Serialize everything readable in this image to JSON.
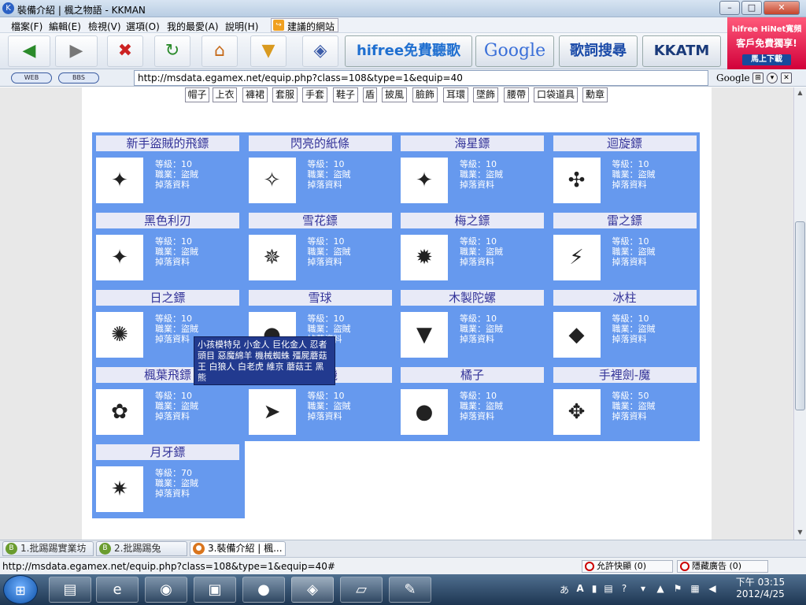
{
  "window": {
    "title": "裝備介紹 | 楓之物語 - KKMAN",
    "icon": "kkman-icon"
  },
  "window_controls": {
    "minimize": "–",
    "maximize": "□",
    "close": "✕"
  },
  "menu": [
    "檔案(F)",
    "編輯(E)",
    "檢視(V)",
    "選項(O)",
    "我的最愛(A)",
    "說明(H)"
  ],
  "suggest_label": "建議的網站",
  "banners": {
    "hifree": "hifree免費聽歌",
    "google": "Google",
    "lyrics": "歌詞搜尋",
    "kkatm": "KKATM"
  },
  "hinet": {
    "line1": "hifree HiNet寬頻",
    "line2": "客戶免費獨享!",
    "button": "馬上下載"
  },
  "address": {
    "pill1": "WEB",
    "pill2": "BBS",
    "url": "http://msdata.egamex.net/equip.php?class=108&type=1&equip=40",
    "search_brand": "Google"
  },
  "categories": [
    "帽子",
    "上衣",
    "褲裙",
    "套服",
    "手套",
    "鞋子",
    "盾",
    "披風",
    "臉飾",
    "耳環",
    "墜飾",
    "腰帶",
    "口袋道具",
    "勳章"
  ],
  "info_labels": {
    "level": "等級：",
    "job": "職業：",
    "drop": "掉落資料"
  },
  "items": [
    {
      "name": "新手盜賊的飛鏢",
      "level": "10",
      "job": "盜賊",
      "icon": "✦"
    },
    {
      "name": "閃亮的紙條",
      "level": "10",
      "job": "盜賊",
      "icon": "✧"
    },
    {
      "name": "海星鏢",
      "level": "10",
      "job": "盜賊",
      "icon": "✦"
    },
    {
      "name": "迴旋鏢",
      "level": "10",
      "job": "盜賊",
      "icon": "✣"
    },
    {
      "name": "黑色利刃",
      "level": "10",
      "job": "盜賊",
      "icon": "✦"
    },
    {
      "name": "雪花鏢",
      "level": "10",
      "job": "盜賊",
      "icon": "✵"
    },
    {
      "name": "梅之鏢",
      "level": "10",
      "job": "盜賊",
      "icon": "✹"
    },
    {
      "name": "雷之鏢",
      "level": "10",
      "job": "盜賊",
      "icon": "⚡"
    },
    {
      "name": "日之鏢",
      "level": "10",
      "job": "盜賊",
      "icon": "✺"
    },
    {
      "name": "雪球",
      "level": "10",
      "job": "盜賊",
      "icon": "●"
    },
    {
      "name": "木製陀螺",
      "level": "10",
      "job": "盜賊",
      "icon": "▼"
    },
    {
      "name": "冰柱",
      "level": "10",
      "job": "盜賊",
      "icon": "◆"
    },
    {
      "name": "楓葉飛鏢",
      "level": "10",
      "job": "盜賊",
      "icon": "✿"
    },
    {
      "name": "紙飛機",
      "level": "10",
      "job": "盜賊",
      "icon": "➤"
    },
    {
      "name": "橘子",
      "level": "10",
      "job": "盜賊",
      "icon": "●"
    },
    {
      "name": "手裡劍-魔",
      "level": "50",
      "job": "盜賊",
      "icon": "✥"
    },
    {
      "name": "月牙鏢",
      "level": "70",
      "job": "盜賊",
      "icon": "✷"
    }
  ],
  "tooltip": "小孩模特兒 小金人 巨化金人 忍者頭目 惡魔綿羊 機械蜘蛛 殭屍蘑菇王 白狼人 白老虎 維京 蘑菇王 黑熊",
  "tabs": [
    "1.批踢踢實業坊",
    "2.批踢踢兔",
    "3.裝備介紹 | 楓..."
  ],
  "status": {
    "url": "http://msdata.egamex.net/equip.php?class=108&type=1&equip=40#",
    "popup": "允許快顯 (0)",
    "ads": "隱藏廣告 (0)"
  },
  "clock": {
    "time": "下午 03:15",
    "date": "2012/4/25"
  }
}
